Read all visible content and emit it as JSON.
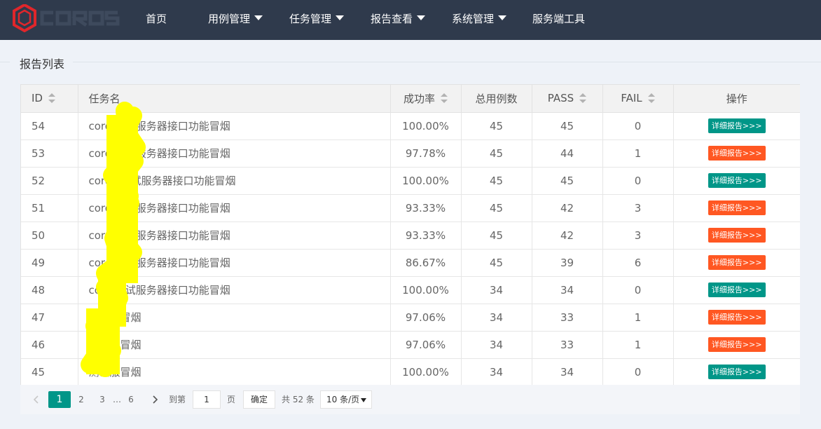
{
  "header": {
    "logo_text": "COROS",
    "nav": [
      {
        "label": "首页",
        "has_dropdown": false
      },
      {
        "label": "用例管理",
        "has_dropdown": true
      },
      {
        "label": "任务管理",
        "has_dropdown": true
      },
      {
        "label": "报告查看",
        "has_dropdown": true
      },
      {
        "label": "系统管理",
        "has_dropdown": true
      },
      {
        "label": "服务端工具",
        "has_dropdown": false
      }
    ]
  },
  "section": {
    "title": "报告列表"
  },
  "table": {
    "columns": [
      "ID",
      "任务名",
      "成功率",
      "总用例数",
      "PASS",
      "FAIL",
      "操作"
    ],
    "action_label": "详细报告>>>",
    "rows": [
      {
        "id": "54",
        "name": "coro  测试服务器接口功能冒烟",
        "rate": "100.00%",
        "total": "45",
        "pass": "45",
        "fail": "0",
        "status": "ok"
      },
      {
        "id": "53",
        "name": "coro  测试服务器接口功能冒烟",
        "rate": "97.78%",
        "total": "45",
        "pass": "44",
        "fail": "1",
        "status": "fail"
      },
      {
        "id": "52",
        "name": "coros  测试服务器接口功能冒烟",
        "rate": "100.00%",
        "total": "45",
        "pass": "45",
        "fail": "0",
        "status": "ok"
      },
      {
        "id": "51",
        "name": "coro  测试服务器接口功能冒烟",
        "rate": "93.33%",
        "total": "45",
        "pass": "42",
        "fail": "3",
        "status": "fail"
      },
      {
        "id": "50",
        "name": "coro  测试服务器接口功能冒烟",
        "rate": "93.33%",
        "total": "45",
        "pass": "42",
        "fail": "3",
        "status": "fail"
      },
      {
        "id": "49",
        "name": "coro  测试服务器接口功能冒烟",
        "rate": "86.67%",
        "total": "45",
        "pass": "39",
        "fail": "6",
        "status": "fail"
      },
      {
        "id": "48",
        "name": "coro  测试服务器接口功能冒烟",
        "rate": "100.00%",
        "total": "34",
        "pass": "34",
        "fail": "0",
        "status": "ok"
      },
      {
        "id": "47",
        "name": "测试服冒烟",
        "rate": "97.06%",
        "total": "34",
        "pass": "33",
        "fail": "1",
        "status": "fail"
      },
      {
        "id": "46",
        "name": "测试服冒烟",
        "rate": "97.06%",
        "total": "34",
        "pass": "33",
        "fail": "1",
        "status": "fail"
      },
      {
        "id": "45",
        "name": "测试服冒烟",
        "rate": "100.00%",
        "total": "34",
        "pass": "34",
        "fail": "0",
        "status": "ok"
      }
    ]
  },
  "pagination": {
    "current": "1",
    "pages": [
      "2",
      "3"
    ],
    "ellipsis": "…",
    "last": "6",
    "goto_label": "到第",
    "goto_value": "1",
    "page_unit": "页",
    "confirm_label": "确定",
    "total_label": "共 52 条",
    "page_size": "10 条/页"
  },
  "colors": {
    "topbar": "#2f3a4c",
    "ok_button": "#009688",
    "fail_button": "#ff5722",
    "logo_red": "#e0262b",
    "redaction": "#ffff00"
  }
}
